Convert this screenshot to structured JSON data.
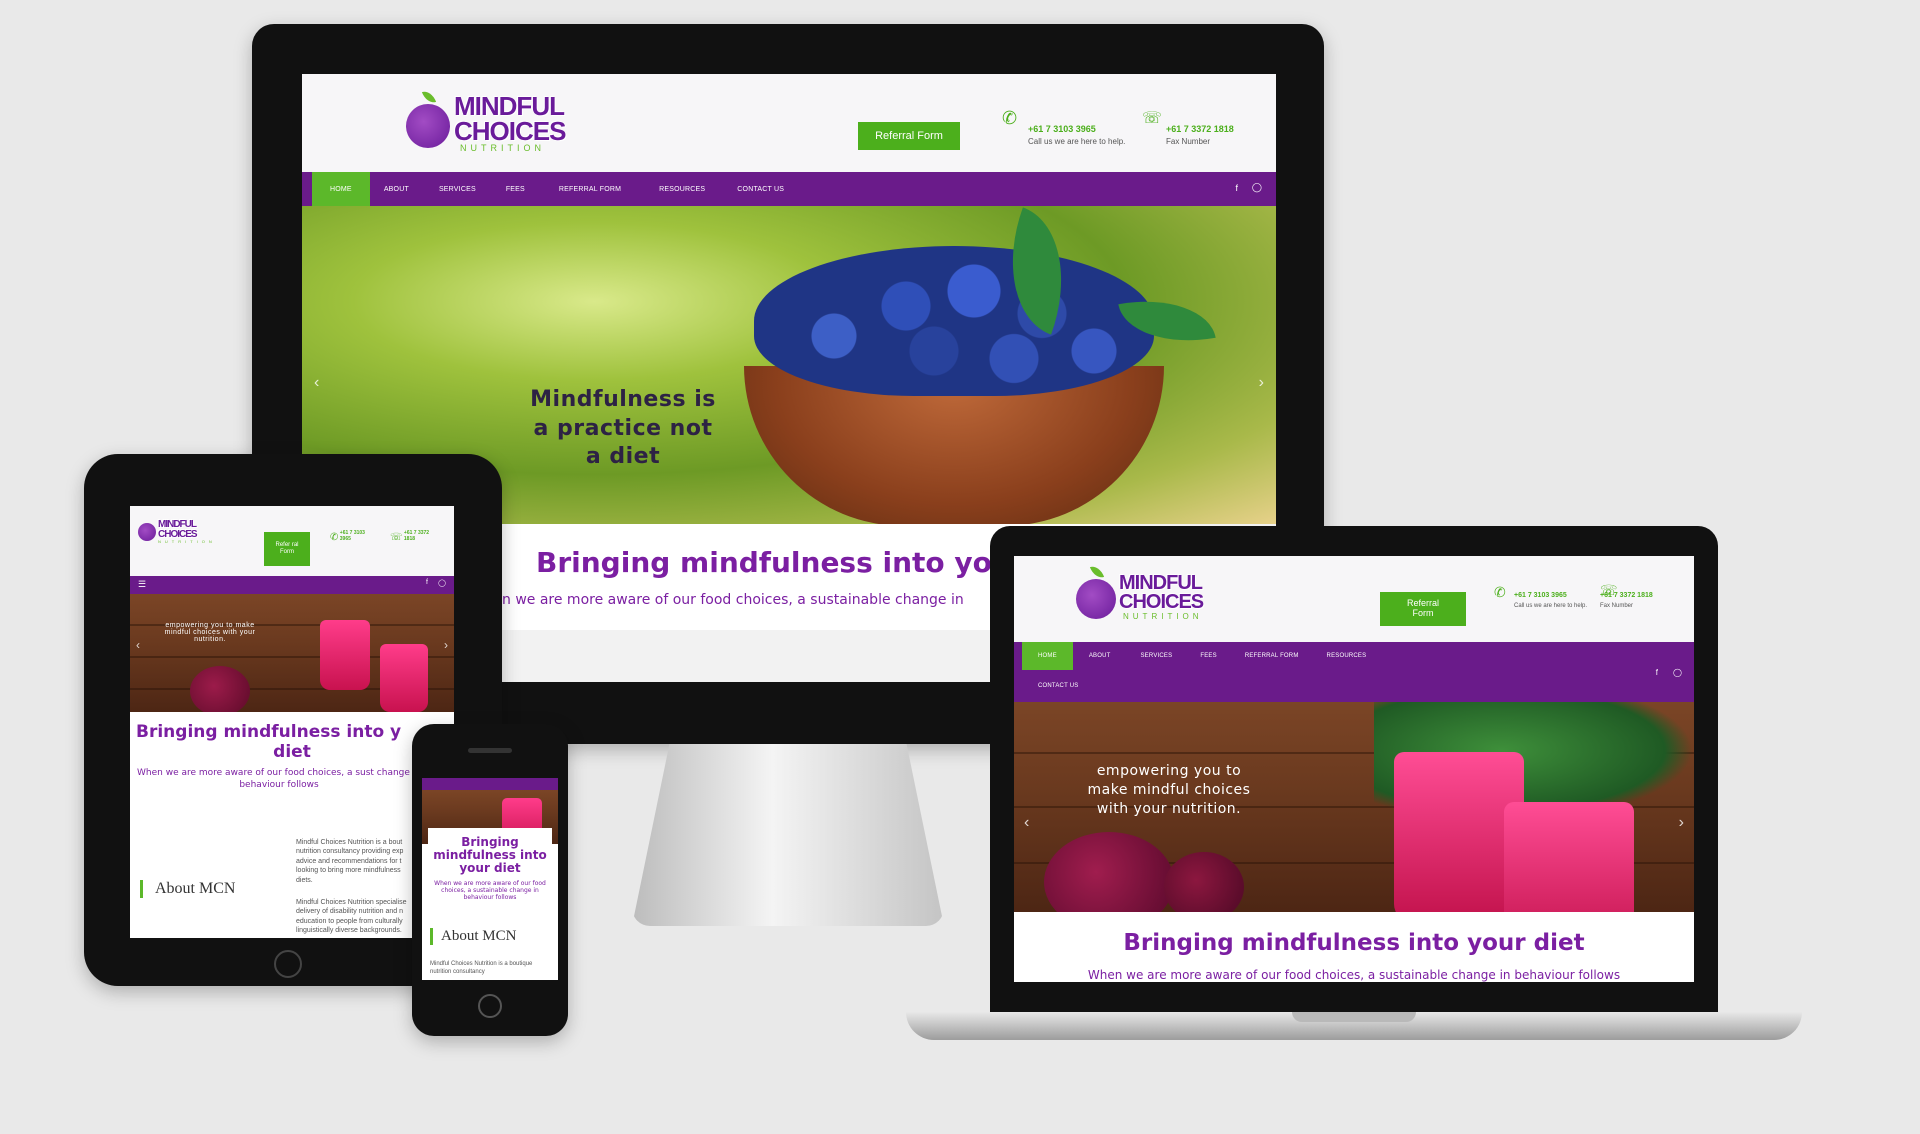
{
  "brand": {
    "name_line1": "MINDFUL",
    "name_line2": "CHOICES",
    "sub": "NUTRITION"
  },
  "header": {
    "referral_button": "Referral Form",
    "referral_button_split": "Refer ral Form",
    "phone": "+61 7 3103 3965",
    "phone_caption": "Call us we are here to help.",
    "fax": "+61 7 3372 1818",
    "fax_caption": "Fax Number"
  },
  "nav": {
    "items": [
      "HOME",
      "ABOUT",
      "SERVICES",
      "FEES",
      "REFERRAL FORM",
      "RESOURCES",
      "CONTACT US"
    ]
  },
  "hero": {
    "desktop_tagline": "Mindfulness is a practice not a diet",
    "beet_tagline": "empowering you to make mindful choices with your nutrition."
  },
  "content": {
    "headline": "Bringing mindfulness into your diet",
    "headline_desktop_visible": "Bringing mindfulness into your d",
    "tablet_headline_l1": "Bringing mindfulness into y",
    "tablet_headline_l2": "diet",
    "desktop_subline": "n we are more aware of our food choices, a sustainable change in",
    "subline": "When we are more aware of our food choices, a sustainable change in behaviour follows",
    "tablet_subline": "When we are more aware of our food choices, a sust change in behaviour follows",
    "phone_subline": "When we are more aware of our food choices, a sustainable change in behaviour follows",
    "about_title": "About MCN",
    "about_text_1": "Mindful Choices Nutrition is a bout nutrition consultancy providing exp advice and recommendations for t looking to bring more mindfulness diets.",
    "about_text_2": "Mindful Choices Nutrition specialise delivery of disability nutrition and n education to people from culturally linguistically diverse backgrounds.",
    "phone_about_text": "Mindful Choices Nutrition is a boutique nutrition consultancy"
  },
  "colors": {
    "purple": "#6a1b8a",
    "green": "#4caf1c",
    "headline_purple": "#7b1fa2"
  }
}
